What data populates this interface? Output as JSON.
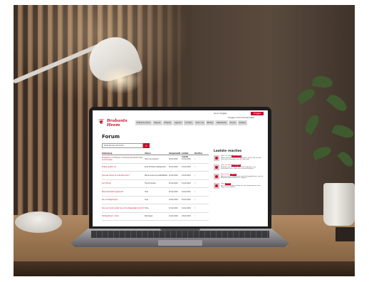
{
  "site": {
    "logo_mark": "❦",
    "logo_line1": "Brabants",
    "logo_line2": "Heem",
    "login_text": "Ga ik inloggen",
    "login_button": "Inloggen",
    "register_text": "Inloggen of Account aanmaken",
    "nav": [
      "Brabants Heem",
      "Nieuws",
      "Erfgoed",
      "Agenda",
      "Contact",
      "Over ons",
      "Bladen",
      "Webwinkel",
      "Forum",
      "Zoeken"
    ],
    "page_title": "Forum",
    "search_value": "Zoek binnen de forum",
    "search_icon": "search-icon",
    "table_headers": [
      "Onderwerp",
      "Auteur",
      "Aangemaakt",
      "Laatste reactie",
      "Reacties"
    ],
    "rows": [
      {
        "topic": "Bouwwerk in de Mayerij: onderzoek gemeente Uden en Groningen",
        "author": "Hans van Gemert",
        "created": "18-02-2020",
        "last": "21-02-2020",
        "count": "3"
      },
      {
        "topic": "Boekje graptor vol",
        "author": "Joost Hinderen (Beheerder)",
        "created": "18-02-2020",
        "last": "19-02-2020",
        "count": "1"
      },
      {
        "topic": "Hoe was het bij de oude Monnickx?",
        "author": "Marie-Louise de Graaf-Baltzer",
        "created": "22-02-2020",
        "last": "24-02-2020",
        "count": "2"
      },
      {
        "topic": "Oud Tilburg",
        "author": "Frans Hanssen",
        "created": "20-02-2020",
        "last": "21-02-2020",
        "count": "4"
      },
      {
        "topic": "Nieuw familielid ingebracht",
        "author": "Huib",
        "created": "18-02-2020",
        "last": "20-02-2020",
        "count": "1"
      },
      {
        "topic": "Zie ook Wageningen",
        "author": "Anja",
        "created": "19-02-2020",
        "last": "20-02-2020",
        "count": "2"
      },
      {
        "topic": "Hoe oud is het oudste huis uit de Meijerijstad bij Sint?",
        "author": "Toine",
        "created": "15-02-2020",
        "last": "19-02-2020",
        "count": "5"
      },
      {
        "topic": "Het Raadhuis 1, Uden",
        "author": "Piet Gijsen",
        "created": "14-02-2020",
        "last": "18-02-2020",
        "count": "2"
      }
    ],
    "sidebar_title": "Laatste reacties",
    "replies": [
      {
        "head": "Hans van Gem",
        "badge": "Oud Tilburg",
        "text": "Mooie stad met historische grachten. Ik ben ook op zoek naar meer informatie over de oude wijk."
      },
      {
        "head": "Joost van Gem",
        "badge": "Dit project",
        "text": "Bedankt voor het delen van deze informatie, erg interessant om te lezen over de geschiedenis."
      },
      {
        "head": "Marie-Louise",
        "badge": "Nieuw",
        "text": "Wat leuk dat er nog steeds zoveel belangstelling is voor de Brabantse geschiedenis en erfgoed."
      },
      {
        "head": "Frans",
        "badge": "Forum",
        "text": "Het is een prachtig verhaal over de oorsprong van onze regio en de tradities."
      }
    ]
  }
}
